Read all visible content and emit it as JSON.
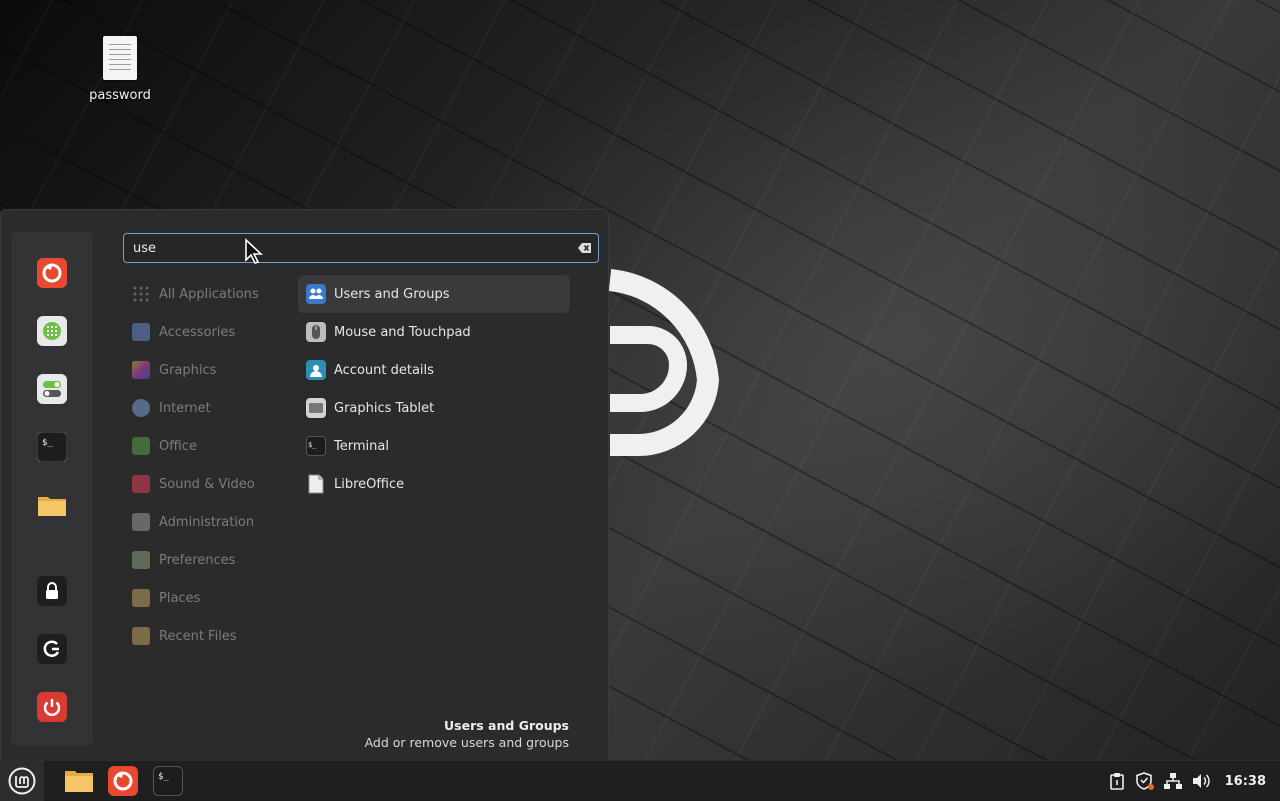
{
  "desktop": {
    "icons": [
      {
        "label": "password",
        "icon": "text-document-icon"
      }
    ]
  },
  "menu": {
    "search": {
      "value": "use",
      "placeholder": ""
    },
    "favorites": [
      {
        "name": "Firefox",
        "icon": "firefox-icon",
        "color": "#e8482f"
      },
      {
        "name": "Calculator",
        "icon": "calculator-icon",
        "color": "#6cc04a"
      },
      {
        "name": "Settings",
        "icon": "settings-toggle-icon",
        "color": "#6cc04a"
      },
      {
        "name": "Terminal",
        "icon": "terminal-icon",
        "color": "#222222"
      },
      {
        "name": "Files",
        "icon": "folder-icon",
        "color": "#f2c15a"
      },
      {
        "name": "Lock Screen",
        "icon": "lock-icon",
        "color": "#1e1e1e"
      },
      {
        "name": "Log Out",
        "icon": "logout-icon",
        "color": "#1e1e1e"
      },
      {
        "name": "Shut Down",
        "icon": "power-icon",
        "color": "#d93a32"
      }
    ],
    "categories": [
      {
        "label": "All Applications",
        "color": "#777777"
      },
      {
        "label": "Accessories",
        "color": "#6a8bd0"
      },
      {
        "label": "Graphics",
        "color": "#b04ac0"
      },
      {
        "label": "Internet",
        "color": "#5aa0e0"
      },
      {
        "label": "Office",
        "color": "#5aa04a"
      },
      {
        "label": "Sound & Video",
        "color": "#e04050"
      },
      {
        "label": "Administration",
        "color": "#9a9a9a"
      },
      {
        "label": "Preferences",
        "color": "#8aa07a"
      },
      {
        "label": "Places",
        "color": "#c0a060"
      },
      {
        "label": "Recent Files",
        "color": "#c0a060"
      }
    ],
    "results": [
      {
        "label": "Users and Groups",
        "icon": "users-icon",
        "color": "#3c79c8",
        "selected": true
      },
      {
        "label": "Mouse and Touchpad",
        "icon": "mouse-icon",
        "color": "#bdbdbd",
        "selected": false
      },
      {
        "label": "Account details",
        "icon": "account-icon",
        "color": "#2e8fb5",
        "selected": false
      },
      {
        "label": "Graphics Tablet",
        "icon": "tablet-icon",
        "color": "#9a9a9a",
        "selected": false
      },
      {
        "label": "Terminal",
        "icon": "terminal-icon",
        "color": "#222222",
        "selected": false
      },
      {
        "label": "LibreOffice",
        "icon": "libreoffice-icon",
        "color": "#eeeeee",
        "selected": false
      }
    ],
    "description": {
      "title": "Users and Groups",
      "text": "Add or remove users and groups"
    }
  },
  "taskbar": {
    "launchers": [
      {
        "name": "Files",
        "icon": "folder-icon"
      },
      {
        "name": "Firefox",
        "icon": "firefox-icon"
      },
      {
        "name": "Terminal",
        "icon": "terminal-icon"
      }
    ],
    "tray": [
      "clipboard-icon",
      "shield-update-icon",
      "network-icon",
      "volume-icon"
    ],
    "clock": "16:38"
  }
}
